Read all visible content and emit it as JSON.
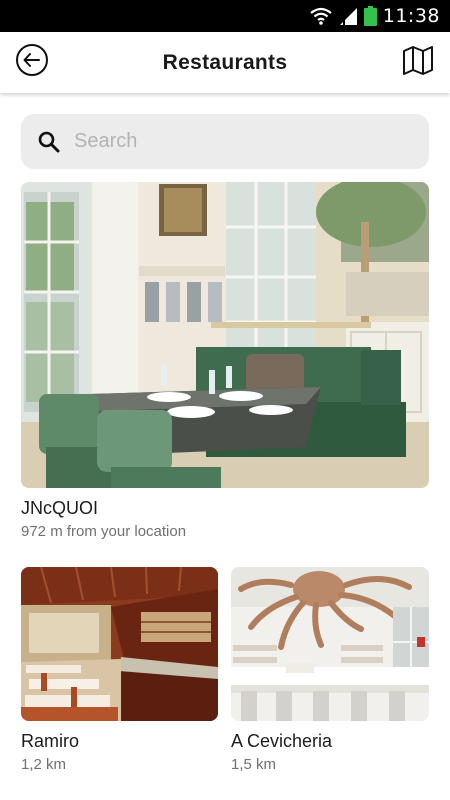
{
  "status_bar": {
    "time": "11:38"
  },
  "header": {
    "title": "Restaurants"
  },
  "search": {
    "placeholder": "Search"
  },
  "restaurants": [
    {
      "name": "JNcQUOI",
      "distance": "972 m from your location"
    },
    {
      "name": "Ramiro",
      "distance": "1,2 km"
    },
    {
      "name": "A Cevicheria",
      "distance": "1,5 km"
    }
  ],
  "colors": {
    "search_bg": "#ececec",
    "placeholder": "#b3b3b3",
    "secondary_text": "#707070",
    "status_bar": "#000000",
    "battery": "#34c24a"
  }
}
